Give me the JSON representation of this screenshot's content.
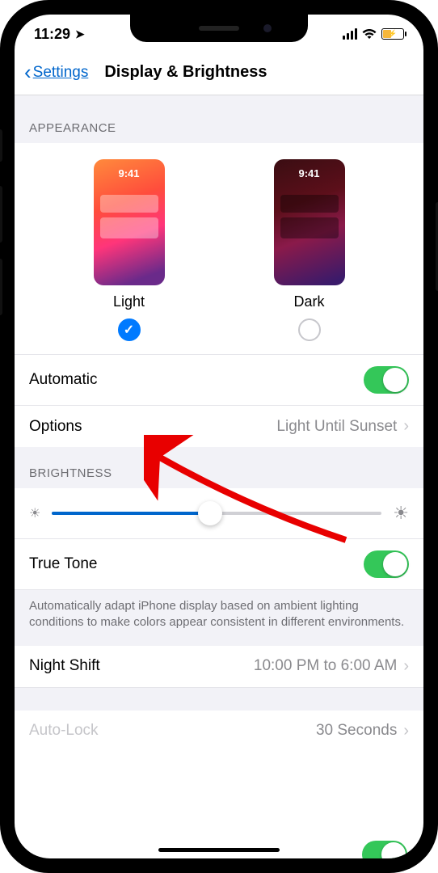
{
  "statusbar": {
    "time": "11:29",
    "location_glyph": "➤"
  },
  "nav": {
    "back_label": "Settings",
    "title": "Display & Brightness"
  },
  "sections": {
    "appearance_header": "APPEARANCE",
    "brightness_header": "BRIGHTNESS"
  },
  "appearance": {
    "preview_time": "9:41",
    "light_label": "Light",
    "dark_label": "Dark",
    "selected": "light"
  },
  "rows": {
    "automatic": {
      "label": "Automatic",
      "on": true
    },
    "options": {
      "label": "Options",
      "value": "Light Until Sunset"
    },
    "truetone": {
      "label": "True Tone",
      "on": true
    },
    "nightshift": {
      "label": "Night Shift",
      "value": "10:00 PM to 6:00 AM"
    },
    "autolock": {
      "label": "Auto-Lock",
      "value": "30 Seconds"
    }
  },
  "truetone_footer": "Automatically adapt iPhone display based on ambient lighting conditions to make colors appear consistent in different environments.",
  "brightness_slider": {
    "percent": 48
  }
}
